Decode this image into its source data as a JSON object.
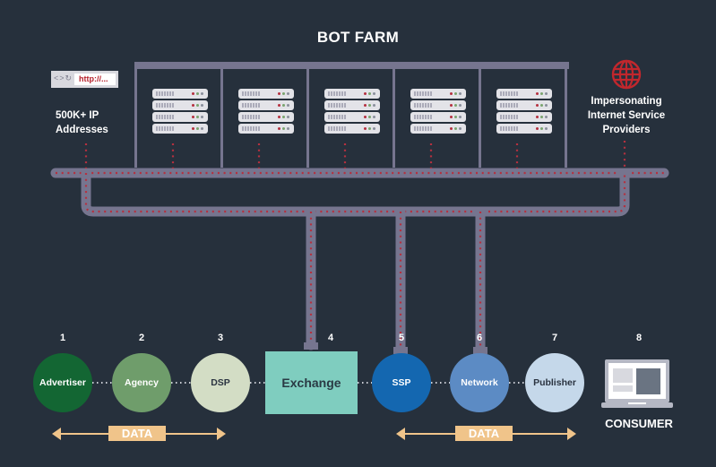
{
  "title": "BOT FARM",
  "browser": {
    "url_text": "http://...",
    "nav_icons": "<>↻"
  },
  "left_label": {
    "line1": "500K+  IP",
    "line2": "Addresses"
  },
  "right_label": {
    "line1": "Impersonating",
    "line2": "Internet Service",
    "line3": "Providers"
  },
  "server_count": 5,
  "colors": {
    "background": "#26303c",
    "cable": "#76758f",
    "cable_dots": "#b5303f",
    "globe": "#c1272d",
    "data": "#f0c48a"
  },
  "nodes": [
    {
      "num": "1",
      "label": "Advertiser",
      "shape": "circle",
      "bg": "#136633",
      "fg": "#ffffff"
    },
    {
      "num": "2",
      "label": "Agency",
      "shape": "circle",
      "bg": "#6f9d6b",
      "fg": "#ffffff"
    },
    {
      "num": "3",
      "label": "DSP",
      "shape": "circle",
      "bg": "#d3ddc5",
      "fg": "#2a3340"
    },
    {
      "num": "4",
      "label": "Exchange",
      "shape": "box",
      "bg": "#7fcdbf",
      "fg": "#2a3a44"
    },
    {
      "num": "5",
      "label": "SSP",
      "shape": "circle",
      "bg": "#1467b0",
      "fg": "#ffffff"
    },
    {
      "num": "6",
      "label": "Network",
      "shape": "circle",
      "bg": "#5c8bc4",
      "fg": "#ffffff"
    },
    {
      "num": "7",
      "label": "Publisher",
      "shape": "circle",
      "bg": "#c5d8ea",
      "fg": "#2a3340"
    },
    {
      "num": "8",
      "label": "CONSUMER",
      "shape": "laptop"
    }
  ],
  "data_arrows": [
    {
      "label": "DATA"
    },
    {
      "label": "DATA"
    }
  ]
}
